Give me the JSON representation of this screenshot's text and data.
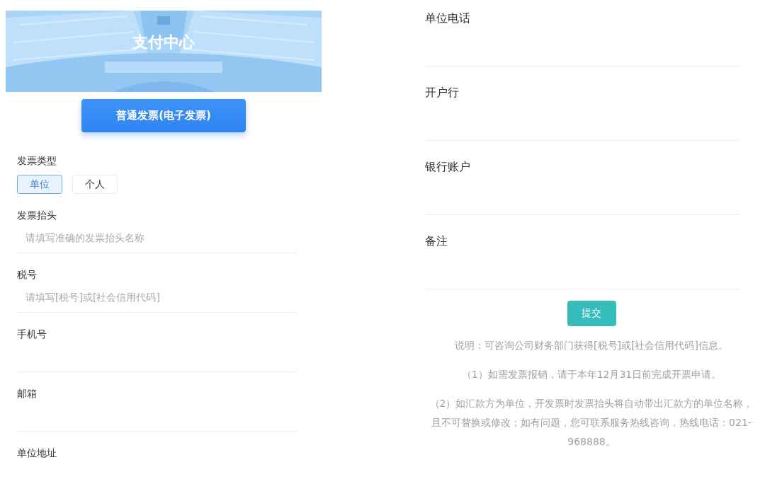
{
  "banner": {
    "kind": "picture",
    "title": "支付中心"
  },
  "invoice_button": "普通发票(电子发票)",
  "invoice_type": {
    "label": "发票类型",
    "options": [
      {
        "label": "单位",
        "selected": true
      },
      {
        "label": "个人",
        "selected": false
      }
    ]
  },
  "fields_left": [
    {
      "label": "发票抬头",
      "placeholder": "请填写准确的发票抬头名称"
    },
    {
      "label": "税号",
      "placeholder": "请填写[税号]或[社会信用代码]"
    },
    {
      "label": "手机号"
    },
    {
      "label": "邮箱"
    },
    {
      "label": "单位地址"
    }
  ],
  "fields_right": [
    {
      "label": "单位电话"
    },
    {
      "label": "开户行"
    },
    {
      "label": "银行账户"
    },
    {
      "label": "备注"
    }
  ],
  "submit": "提交",
  "notes": [
    "说明：可咨询公司财务部门获得[税号]或[社会信用代码]信息。",
    "（1）如需发票报销，请于本年12月31日前完成开票申请。",
    "（2）如汇款方为单位，开发票时发票抬头将自动带出汇款方的单位名称，且不可替换或修改；如有问题，您可联系服务热线咨询，热线电话：021-968888。"
  ]
}
